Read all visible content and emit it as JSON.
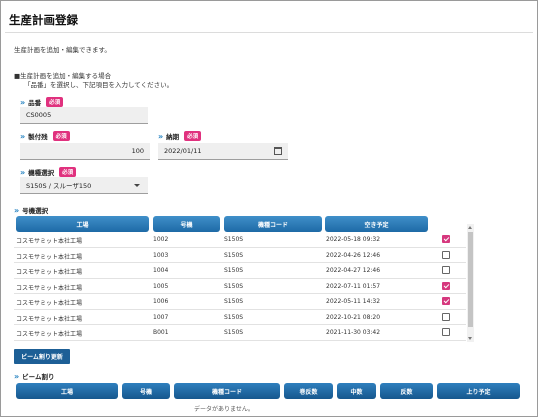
{
  "page": {
    "title": "生産計画登録",
    "description": "生産計画を追加・編集できます。",
    "note_line1": "■生産計画を追加・編集する場合",
    "note_line2": "「品番」を選択し、下記項目を入力してください。"
  },
  "form": {
    "required_badge": "必須",
    "part_no": {
      "label": "品番",
      "value": "CS0005"
    },
    "quantity": {
      "label": "製付残",
      "value": "100"
    },
    "deadline": {
      "label": "納期",
      "value": "2022/01/11"
    },
    "machine_select": {
      "label": "機種選択",
      "value": "S150S / スルーザ150"
    }
  },
  "machine_table": {
    "section_label": "号機選択",
    "headers": [
      "工場",
      "号機",
      "機種コード",
      "空き予定"
    ],
    "rows": [
      {
        "factory": "コスモサミット本社工場",
        "unit": "1002",
        "model": "S150S",
        "available": "2022-05-18 09:32",
        "checked": true
      },
      {
        "factory": "コスモサミット本社工場",
        "unit": "1003",
        "model": "S150S",
        "available": "2022-04-26 12:46",
        "checked": false
      },
      {
        "factory": "コスモサミット本社工場",
        "unit": "1004",
        "model": "S150S",
        "available": "2022-04-27 12:46",
        "checked": false
      },
      {
        "factory": "コスモサミット本社工場",
        "unit": "1005",
        "model": "S150S",
        "available": "2022-07-11 01:57",
        "checked": true
      },
      {
        "factory": "コスモサミット本社工場",
        "unit": "1006",
        "model": "S150S",
        "available": "2022-05-11 14:32",
        "checked": true
      },
      {
        "factory": "コスモサミット本社工場",
        "unit": "1007",
        "model": "S150S",
        "available": "2022-10-21 08:20",
        "checked": false
      },
      {
        "factory": "コスモサミット本社工場",
        "unit": "B001",
        "model": "S150S",
        "available": "2021-11-30 03:42",
        "checked": false
      }
    ]
  },
  "update_button": "ビーム割り更新",
  "beam_table": {
    "section_label": "ビーム割り",
    "headers": [
      "工場",
      "号機",
      "機種コード",
      "巻反数",
      "中数",
      "反数",
      "上り予定"
    ],
    "empty_text": "データがありません。"
  },
  "colors": {
    "header_blue": "#1e6aa6",
    "required_pink": "#e0317e",
    "checkbox_pink": "#d6387e",
    "button_navy": "#1d5f96"
  },
  "icons": [
    "chevron-double-right-icon",
    "calendar-icon",
    "dropdown-caret-icon",
    "checkbox-icon"
  ]
}
